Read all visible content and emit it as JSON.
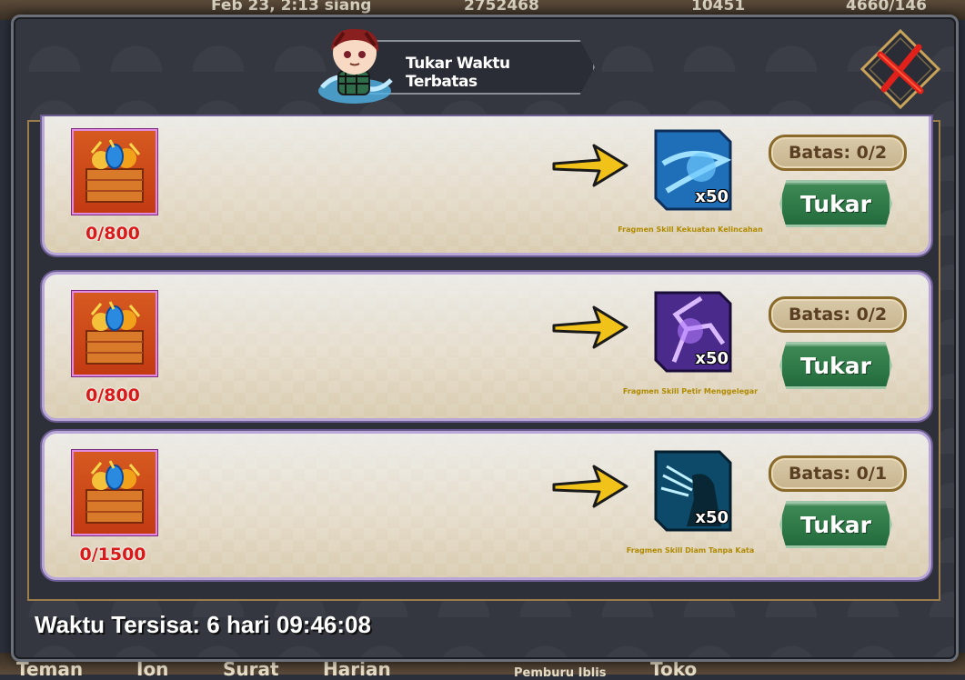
{
  "title": "Tukar Waktu Terbatas",
  "background": {
    "top_texts": [
      "Feb 23, 2:13 siang",
      "2752468",
      "10451",
      "4660/146"
    ],
    "bottom_texts": [
      "Teman",
      "Ion",
      "Surat",
      "Harian",
      "Pemburu Iblis",
      "Toko"
    ]
  },
  "rows": [
    {
      "cost": "0/800",
      "reward_qty": "x50",
      "reward_name": "Fragmen Skill Kekuatan Kelincahan",
      "limit": "Batas: 0/2",
      "button": "Tukar"
    },
    {
      "cost": "0/800",
      "reward_qty": "x50",
      "reward_name": "Fragmen Skill Petir Menggelegar",
      "limit": "Batas: 0/2",
      "button": "Tukar"
    },
    {
      "cost": "0/1500",
      "reward_qty": "x50",
      "reward_name": "Fragmen Skill Diam Tanpa Kata",
      "limit": "Batas: 0/1",
      "button": "Tukar"
    }
  ],
  "timer": "Waktu Tersisa: 6 hari 09:46:08",
  "colors": {
    "cost_red": "#d81a1a",
    "button_green": "#2f7a48",
    "close_red": "#e0201a",
    "panel_gold": "#9a7d4a"
  },
  "icons": {
    "close": "close-x-icon",
    "arrow": "arrow-right-icon",
    "chest": "gift-chest-icon"
  }
}
